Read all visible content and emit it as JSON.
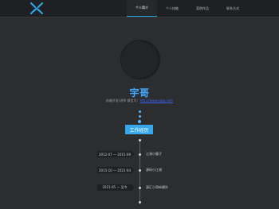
{
  "header": {
    "logo_icon": "x-logo-icon",
    "nav": [
      {
        "label": "个人简介",
        "active": true
      },
      {
        "label": "个人技能",
        "active": false
      },
      {
        "label": "案例作品",
        "active": false
      },
      {
        "label": "联系方式",
        "active": false
      }
    ]
  },
  "profile": {
    "name": "宇哥",
    "subtitle_prefix": "前端开发/讲师 微信号：",
    "subtitle_link": "http://www.sqtq.com"
  },
  "experience_button": "工作经历",
  "timeline": [
    {
      "date": "2012-07 — 2015-09",
      "text": "江湖小霸子"
    },
    {
      "date": "2015-10 — 2021-04",
      "text": "源码小江湖"
    },
    {
      "date": "2021-05 — 至今",
      "text": "源汇小哥纵横外"
    }
  ],
  "colors": {
    "accent": "#1aa3e8",
    "name": "#42a8ff",
    "background": "#2c2d2f"
  }
}
